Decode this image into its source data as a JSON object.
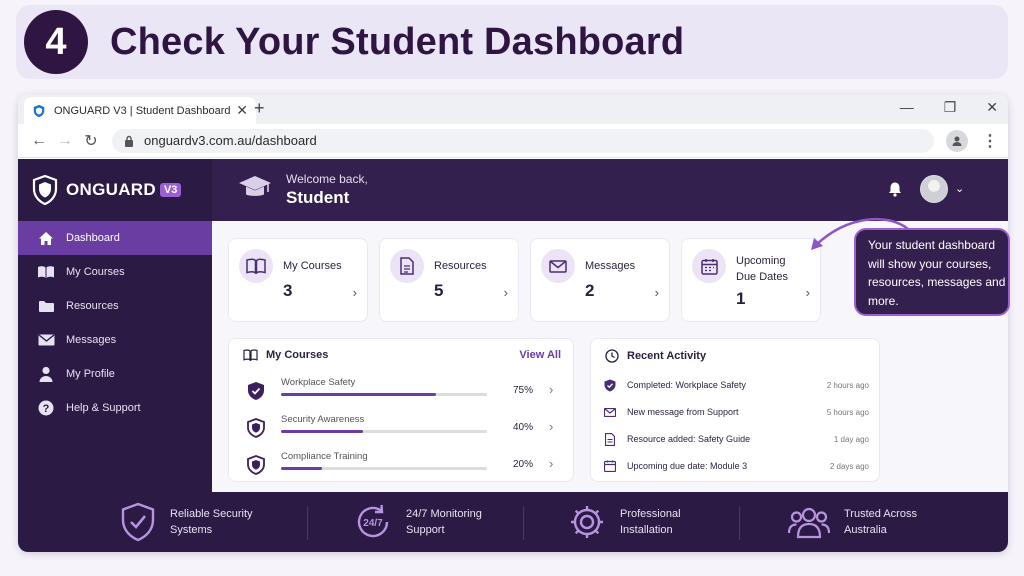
{
  "banner": {
    "step": "4",
    "title": "Check Your Student Dashboard"
  },
  "browser": {
    "tab_title": "ONGUARD V3 | Student Dashboard",
    "url": "onguardv3.com.au/dashboard"
  },
  "sidebar": {
    "logo": "ONGUARD",
    "logo_badge": "V3",
    "items": [
      {
        "label": "Dashboard",
        "icon": "home-icon"
      },
      {
        "label": "My Courses",
        "icon": "book-icon"
      },
      {
        "label": "Resources",
        "icon": "folder-icon"
      },
      {
        "label": "Messages",
        "icon": "mail-icon"
      },
      {
        "label": "My Profile",
        "icon": "user-icon"
      },
      {
        "label": "Help & Support",
        "icon": "help-icon"
      }
    ]
  },
  "header": {
    "welcome": "Welcome back,",
    "name": "Student"
  },
  "stats": [
    {
      "label": "My Courses",
      "value": "3"
    },
    {
      "label": "Resources",
      "value": "5"
    },
    {
      "label": "Messages",
      "value": "2"
    },
    {
      "label": "Upcoming Due Dates",
      "value": "1"
    }
  ],
  "callout": "Your student dashboard will show your courses, resources, messages and more.",
  "courses": {
    "title": "My Courses",
    "view_all": "View All",
    "items": [
      {
        "name": "Workplace Safety",
        "percent": "75%",
        "progress": 0.75
      },
      {
        "name": "Security Awareness",
        "percent": "40%",
        "progress": 0.4
      },
      {
        "name": "Compliance Training",
        "percent": "20%",
        "progress": 0.2
      }
    ]
  },
  "activity": {
    "title": "Recent Activity",
    "items": [
      {
        "text": "Completed: Workplace Safety",
        "time": "2 hours ago",
        "icon": "shield-check-icon"
      },
      {
        "text": "New message from Support",
        "time": "5 hours ago",
        "icon": "mail-icon"
      },
      {
        "text": "Resource added: Safety Guide",
        "time": "1 day ago",
        "icon": "document-icon"
      },
      {
        "text": "Upcoming due date: Module 3",
        "time": "2 days ago",
        "icon": "calendar-icon"
      }
    ]
  },
  "features": [
    {
      "line1": "Reliable Security",
      "line2": "Systems",
      "icon": "shield-check-icon"
    },
    {
      "line1": "24/7 Monitoring",
      "line2": "Support",
      "icon": "clock-24-7-icon",
      "icon_text": "24/7"
    },
    {
      "line1": "Professional",
      "line2": "Installation",
      "icon": "gear-icon"
    },
    {
      "line1": "Trusted Across",
      "line2": "Australia",
      "icon": "users-icon"
    }
  ],
  "colors": {
    "primary_dark": "#2a1a44",
    "accent": "#6a3da3",
    "accent_light": "#9b5fd4"
  }
}
